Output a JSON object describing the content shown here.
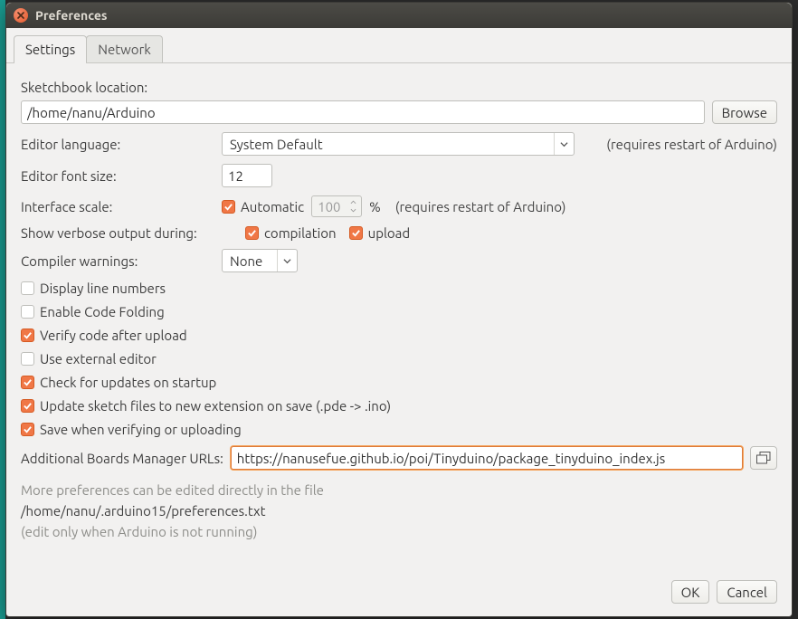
{
  "window": {
    "title": "Preferences"
  },
  "tabs": {
    "settings": "Settings",
    "network": "Network"
  },
  "sketchbook": {
    "label": "Sketchbook location:",
    "value": "/home/nanu/Arduino",
    "browse": "Browse"
  },
  "editorLanguage": {
    "label": "Editor language:",
    "value": "System Default",
    "hint": "(requires restart of Arduino)"
  },
  "editorFontSize": {
    "label": "Editor font size:",
    "value": "12"
  },
  "interfaceScale": {
    "label": "Interface scale:",
    "autoLabel": "Automatic",
    "percent": "100",
    "pctSuffix": "%",
    "hint": "(requires restart of Arduino)"
  },
  "verbose": {
    "label": "Show verbose output during:",
    "compilation": "compilation",
    "upload": "upload"
  },
  "compilerWarnings": {
    "label": "Compiler warnings:",
    "value": "None"
  },
  "options": {
    "displayLineNumbers": "Display line numbers",
    "enableCodeFolding": "Enable Code Folding",
    "verifyAfterUpload": "Verify code after upload",
    "useExternalEditor": "Use external editor",
    "checkUpdates": "Check for updates on startup",
    "updateExt": "Update sketch files to new extension on save (.pde -> .ino)",
    "saveVerify": "Save when verifying or uploading"
  },
  "boardsUrls": {
    "label": "Additional Boards Manager URLs:",
    "value": "https://nanusefue.github.io/poi/Tinyduino/package_tinyduino_index.js"
  },
  "moreInfo": {
    "line1": "More preferences can be edited directly in the file",
    "path": "/home/nanu/.arduino15/preferences.txt",
    "line3": "(edit only when Arduino is not running)"
  },
  "buttons": {
    "ok": "OK",
    "cancel": "Cancel"
  }
}
